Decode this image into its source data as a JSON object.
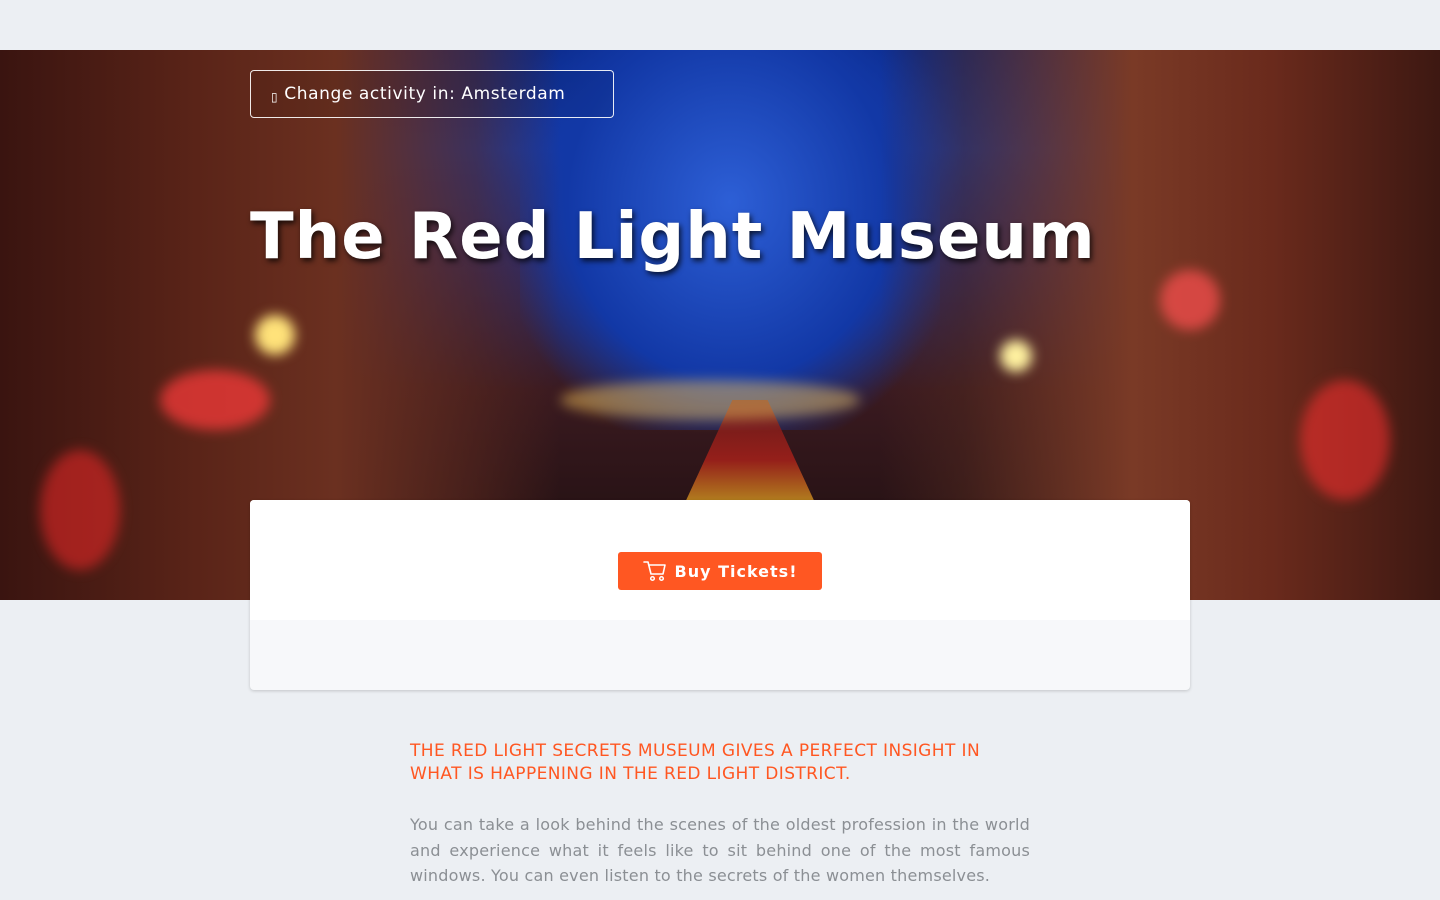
{
  "header": {
    "change_activity_icon": "map-pin-icon",
    "change_activity_glyph": "▯",
    "change_activity_label": "Change activity in: Amsterdam"
  },
  "hero": {
    "title": "The Red Light Museum",
    "image_subject": "amsterdam-red-light-district-canal-at-night"
  },
  "booking": {
    "buy_icon": "shopping-cart-icon",
    "buy_label": "Buy Tickets!"
  },
  "intro": {
    "heading": "THE RED LIGHT SECRETS MUSEUM GIVES A PERFECT INSIGHT IN WHAT IS HAPPENING IN THE RED LIGHT DISTRICT.",
    "body": "You can take a look behind the scenes of the oldest profession in the world and experience what it feels like to sit behind one of the most famous windows. You can even listen to the secrets of the women themselves."
  },
  "colors": {
    "accent": "#ff5722",
    "page_background": "#eceff3",
    "body_text": "#8b8f94"
  }
}
